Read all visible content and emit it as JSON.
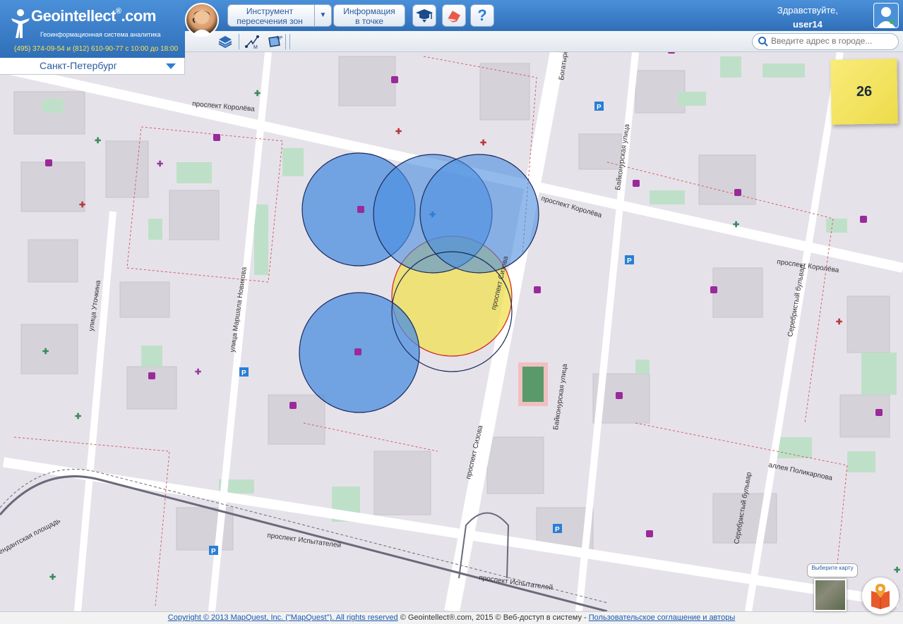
{
  "header": {
    "logo_text": "Geointellect",
    "logo_suffix": ".com",
    "logo_sub": "Геоинформационная система аналитика",
    "phone": "(495) 374-09-54 и (812) 610-90-77 с 10:00 до 18:00",
    "btn_zones_line1": "Инструмент",
    "btn_zones_line2": "пересечения зон",
    "btn_info_line1": "Информация",
    "btn_info_line2": "в точке",
    "help": "?",
    "greeting": "Здравствуйте,",
    "username": "user14"
  },
  "search": {
    "placeholder": "Введите адрес в городе..."
  },
  "city": {
    "name": "Санкт-Петербург"
  },
  "sticky": {
    "value": "26"
  },
  "map_labels": [
    {
      "text": "проспект Королёва"
    },
    {
      "text": "проспект Королёва"
    },
    {
      "text": "проспект Королёва"
    },
    {
      "text": "улица Уточкина"
    },
    {
      "text": "улица Маршала Новикова"
    },
    {
      "text": "проспект Сизова"
    },
    {
      "text": "проспект Сизова"
    },
    {
      "text": "Байконурская улица"
    },
    {
      "text": "Байконурская улица"
    },
    {
      "text": "Серебристый бульвар"
    },
    {
      "text": "Серебристый бульвар"
    },
    {
      "text": "аллея Поликарпова"
    },
    {
      "text": "проспект Испытателей"
    },
    {
      "text": "проспект Испытателей"
    },
    {
      "text": "Богатырский проспект"
    },
    {
      "text": "ендантская площадь"
    }
  ],
  "map_select": {
    "label": "Выберите карту"
  },
  "footer": {
    "copyright_link": "Copyright © 2013 MapQuest, Inc. (\"MapQuest\"). All rights reserved",
    "middle": " © Geointellect®.com, 2015 © Веб-доступ в систему - ",
    "terms_link": "Пользовательское соглашение и авторы"
  },
  "colors": {
    "header_blue": "#2f6fb8",
    "zone_blue": "#4a8ee0",
    "zone_yellow": "#f0e050",
    "sticky_yellow": "#f8ec7a"
  }
}
